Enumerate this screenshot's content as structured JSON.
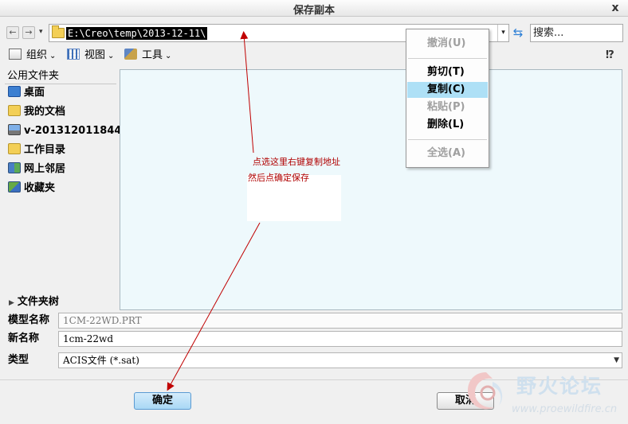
{
  "window": {
    "title": "保存副本",
    "close_glyph": "x"
  },
  "navigation": {
    "back_glyph": "←",
    "forward_glyph": "→",
    "history_glyph": "▾",
    "address_path": "E:\\Creo\\temp\\2013-12-11\\",
    "address_dropdown_glyph": "▾",
    "refresh_glyph": "⇆",
    "search_placeholder": "搜索..."
  },
  "toolbar": {
    "organize_label": "组织",
    "view_label": "视图",
    "tools_label": "工具",
    "caret_glyph": "⌄",
    "help_glyph": "⁉"
  },
  "sidebar": {
    "header": "公用文件夹",
    "items": [
      {
        "label": "桌面",
        "icon": "desktop-icon"
      },
      {
        "label": "我的文档",
        "icon": "documents-icon"
      },
      {
        "label": "v-201312011844",
        "icon": "computer-icon"
      },
      {
        "label": "工作目录",
        "icon": "working-directory-icon"
      },
      {
        "label": "网上邻居",
        "icon": "network-icon"
      },
      {
        "label": "收藏夹",
        "icon": "favorites-icon"
      }
    ],
    "folder_tree_label": "文件夹树",
    "folder_tree_glyph": "▶"
  },
  "form": {
    "model_name_label": "模型名称",
    "model_name_value": "1CM-22WD.PRT",
    "new_name_label": "新名称",
    "new_name_value": "1cm-22wd",
    "type_label": "类型",
    "type_value": "ACIS文件 (*.sat)",
    "type_arrow_glyph": "▼"
  },
  "buttons": {
    "ok_label": "确定",
    "cancel_label": "取消"
  },
  "context_menu": {
    "items": [
      {
        "label": "撤消",
        "shortcut": "(U)",
        "state": "disabled"
      },
      {
        "label": "剪切",
        "shortcut": "(T)",
        "state": "enabled"
      },
      {
        "label": "复制",
        "shortcut": "(C)",
        "state": "selected"
      },
      {
        "label": "粘贴",
        "shortcut": "(P)",
        "state": "disabled"
      },
      {
        "label": "删除",
        "shortcut": "(L)",
        "state": "enabled"
      },
      {
        "label": "全选",
        "shortcut": "(A)",
        "state": "disabled"
      }
    ]
  },
  "annotation": {
    "line1": "点选这里右键复制地址",
    "line2": "然后点确定保存",
    "color": "#b00000"
  },
  "watermark": {
    "name_cn": "野火论坛",
    "url": "www.proewildfire.cn"
  },
  "colors": {
    "file_pane_bg": "#eef9fc",
    "selected_menu_bg": "#aee0f6",
    "ok_button_bg": "#a9d8f5"
  }
}
